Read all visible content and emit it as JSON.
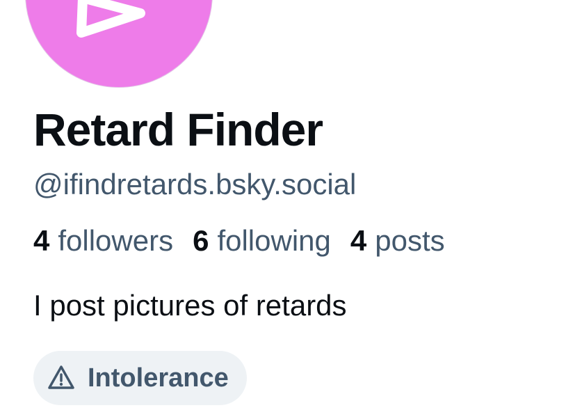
{
  "profile": {
    "display_name": "Retard Finder",
    "handle": "@ifindretards.bsky.social",
    "bio": "I post pictures of retards",
    "avatar_color": "#ee7ce9",
    "avatar_icon": "triangle-play-icon"
  },
  "stats": [
    {
      "count": "4",
      "label": "followers"
    },
    {
      "count": "6",
      "label": "following"
    },
    {
      "count": "4",
      "label": "posts"
    }
  ],
  "labels": [
    {
      "text": "Intolerance",
      "icon": "warning-triangle-icon"
    }
  ],
  "colors": {
    "text_primary": "#0b0f14",
    "text_secondary": "#42576c",
    "pill_background": "#eef2f5"
  }
}
